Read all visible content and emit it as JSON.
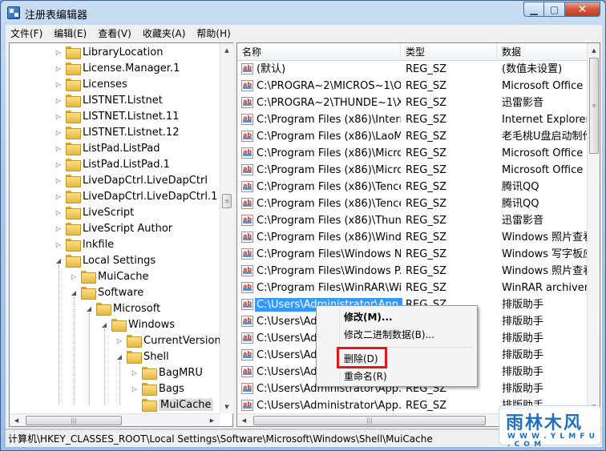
{
  "window": {
    "title": "注册表编辑器",
    "minimize_glyph": "▁",
    "maximize_glyph": "▢",
    "close_glyph": "✕"
  },
  "menu": [
    "文件(F)",
    "编辑(E)",
    "查看(V)",
    "收藏夹(A)",
    "帮助(H)"
  ],
  "tree": [
    {
      "label": "LibraryLocation",
      "level": 0,
      "expander": "▷"
    },
    {
      "label": "License.Manager.1",
      "level": 0,
      "expander": "▷"
    },
    {
      "label": "Licenses",
      "level": 0,
      "expander": "▷"
    },
    {
      "label": "LISTNET.Listnet",
      "level": 0,
      "expander": "▷"
    },
    {
      "label": "LISTNET.Listnet.11",
      "level": 0,
      "expander": "▷"
    },
    {
      "label": "LISTNET.Listnet.12",
      "level": 0,
      "expander": "▷"
    },
    {
      "label": "ListPad.ListPad",
      "level": 0,
      "expander": "▷"
    },
    {
      "label": "ListPad.ListPad.1",
      "level": 0,
      "expander": "▷"
    },
    {
      "label": "LiveDapCtrl.LiveDapCtrl",
      "level": 0,
      "expander": "▷"
    },
    {
      "label": "LiveDapCtrl.LiveDapCtrl.1",
      "level": 0,
      "expander": "▷"
    },
    {
      "label": "LiveScript",
      "level": 0,
      "expander": "▷"
    },
    {
      "label": "LiveScript Author",
      "level": 0,
      "expander": "▷"
    },
    {
      "label": "lnkfile",
      "level": 0,
      "expander": "▷"
    },
    {
      "label": "Local Settings",
      "level": 0,
      "expander": "◢"
    },
    {
      "label": "MuiCache",
      "level": 1,
      "expander": "▷"
    },
    {
      "label": "Software",
      "level": 1,
      "expander": "◢"
    },
    {
      "label": "Microsoft",
      "level": 2,
      "expander": "◢"
    },
    {
      "label": "Windows",
      "level": 3,
      "expander": "◢"
    },
    {
      "label": "CurrentVersion",
      "level": 4,
      "expander": "▷"
    },
    {
      "label": "Shell",
      "level": 4,
      "expander": "◢"
    },
    {
      "label": "BagMRU",
      "level": 5,
      "expander": "▷"
    },
    {
      "label": "Bags",
      "level": 5,
      "expander": "▷"
    },
    {
      "label": "MuiCache",
      "level": 5,
      "expander": "",
      "selected": true
    }
  ],
  "list": {
    "columns": [
      "名称",
      "类型",
      "数据"
    ],
    "rows": [
      {
        "name": "(默认)",
        "type": "REG_SZ",
        "data": "(数值未设置)"
      },
      {
        "name": "C:\\PROGRA~2\\MICROS~1\\O...",
        "type": "REG_SZ",
        "data": "Microsoft Office Pi"
      },
      {
        "name": "C:\\PROGRA~2\\THUNDE~1\\X...",
        "type": "REG_SZ",
        "data": "迅雷影音"
      },
      {
        "name": "C:\\Program Files (x86)\\Intern...",
        "type": "REG_SZ",
        "data": "Internet Explorer"
      },
      {
        "name": "C:\\Program Files (x86)\\LaoM...",
        "type": "REG_SZ",
        "data": "老毛桃U盘启动制作"
      },
      {
        "name": "C:\\Program Files (x86)\\Micro...",
        "type": "REG_SZ",
        "data": "Microsoft Office Po"
      },
      {
        "name": "C:\\Program Files (x86)\\Micro...",
        "type": "REG_SZ",
        "data": "Microsoft Office W"
      },
      {
        "name": "C:\\Program Files (x86)\\Tence...",
        "type": "REG_SZ",
        "data": "腾讯QQ"
      },
      {
        "name": "C:\\Program Files (x86)\\Tence...",
        "type": "REG_SZ",
        "data": "腾讯QQ"
      },
      {
        "name": "C:\\Program Files (x86)\\Thund...",
        "type": "REG_SZ",
        "data": "迅雷影音"
      },
      {
        "name": "C:\\Program Files (x86)\\Wind...",
        "type": "REG_SZ",
        "data": "Windows 照片查看器"
      },
      {
        "name": "C:\\Program Files\\Windows N...",
        "type": "REG_SZ",
        "data": "Windows 写字板应用"
      },
      {
        "name": "C:\\Program Files\\Windows P...",
        "type": "REG_SZ",
        "data": "Windows 照片查看器"
      },
      {
        "name": "C:\\Program Files\\WinRAR\\Wi...",
        "type": "REG_SZ",
        "data": "WinRAR archiver"
      },
      {
        "name": "C:\\Users\\Administrator\\App...",
        "type": "REG_SZ",
        "data": "排版助手",
        "selected": true
      },
      {
        "name": "C:\\Users\\Adm",
        "type": "REG_SZ",
        "data": "排版助手"
      },
      {
        "name": "C:\\Users\\Adm",
        "type": "REG_SZ",
        "data": "排版助手"
      },
      {
        "name": "C:\\Users\\Adm",
        "type": "REG_SZ",
        "data": "排版助手"
      },
      {
        "name": "C:\\Users\\Adm",
        "type": "REG_SZ",
        "data": "排版助手"
      },
      {
        "name": "C:\\Users\\Administrator\\App...",
        "type": "REG_SZ",
        "data": "排版助手"
      },
      {
        "name": "C:\\Users\\Administrator\\App...",
        "type": "REG_SZ",
        "data": "排版助手"
      }
    ]
  },
  "context_menu": {
    "modify": "修改(M)...",
    "modify_binary": "修改二进制数据(B)...",
    "delete": "删除(D)",
    "rename": "重命名(R)"
  },
  "reg_icon_text": "ab",
  "scroll": {
    "up": "▲",
    "down": "▼",
    "left": "◀",
    "right": "▶",
    "hthumb_glyph": "|||",
    "vthumb_glyph": "≡"
  },
  "status": "计算机\\HKEY_CLASSES_ROOT\\Local Settings\\Software\\Microsoft\\Windows\\Shell\\MuiCache",
  "watermark": {
    "logo": "雨林木风",
    "url": "W W W . Y L M F U . C O M"
  }
}
